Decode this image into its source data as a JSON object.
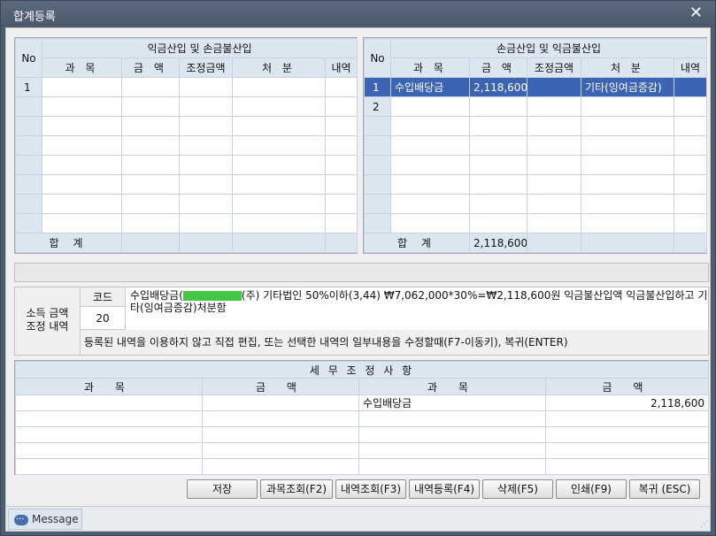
{
  "window": {
    "title": "합계등록",
    "close_glyph": "✕"
  },
  "left_grid": {
    "header": {
      "no": "No",
      "group": "익금산입 및 손금불산입",
      "col1": "과 목",
      "col2": "금 액",
      "col3": "조정금액",
      "col4": "처 분",
      "col5": "내역"
    },
    "rows": [
      {
        "no": "1"
      }
    ],
    "total_label": "합 계",
    "total_amount": ""
  },
  "right_grid": {
    "header": {
      "no": "No",
      "group": "손금산입 및 익금불산입",
      "col1": "과 목",
      "col2": "금 액",
      "col3": "조정금액",
      "col4": "처 분",
      "col5": "내역"
    },
    "rows": [
      {
        "no": "1",
        "subject": "수입배당금",
        "amount": "2,118,600",
        "adjust": "",
        "disposal": "기타(잉여금증감)",
        "detail": ""
      },
      {
        "no": "2"
      }
    ],
    "total_label": "합 계",
    "total_amount": "2,118,600"
  },
  "adjustment": {
    "label_line1": "소득 금액",
    "label_line2": "조정 내역",
    "code_header": "코드",
    "code_value": "20",
    "desc_before": "수입배당금(",
    "desc_after": "(주) 기타법인 50%이하(3,44) ₩7,062,000*30%=₩2,118,600원 익금불산입액 익금불산입하고 기타(잉여금증감)처분함",
    "hint": "등록된 내역을 이용하지 않고 직접 편집, 또는 선택한 내역의 일부내용을 수정할때(F7-이동키), 복귀(ENTER)"
  },
  "tax_table": {
    "title": "세 무 조 정 사 항",
    "headers": [
      "과 목",
      "금 액",
      "과 목",
      "금 액"
    ],
    "rows": [
      [
        "",
        "",
        "수입배당금",
        "2,118,600"
      ],
      [
        "",
        "",
        "",
        ""
      ],
      [
        "",
        "",
        "",
        ""
      ],
      [
        "",
        "",
        "",
        ""
      ],
      [
        "",
        "",
        "",
        ""
      ]
    ]
  },
  "buttons": [
    "저장",
    "과목조회(F2)",
    "내역조회(F3)",
    "내역등록(F4)",
    "삭제(F5)",
    "인쇄(F9)",
    "복귀 (ESC)"
  ],
  "message_tab": "Message",
  "colors": {
    "header_bg": "#dce6f1",
    "selected_row": "#3b64b4",
    "title_bar": "#4e5d6f"
  }
}
